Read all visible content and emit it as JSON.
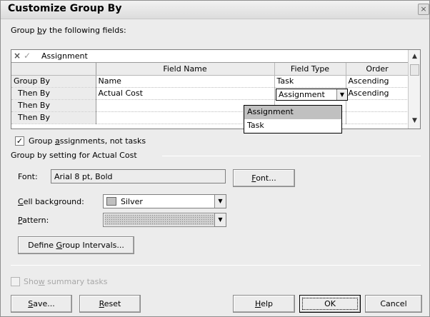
{
  "dialog": {
    "title": "Customize Group By",
    "close_glyph": "×",
    "group_fields_label_pre": "Group ",
    "group_fields_label_u": "b",
    "group_fields_label_post": "y the following fields:"
  },
  "edit_bar": {
    "cancel_glyph": "×",
    "accept_glyph": "✓",
    "value": "Assignment"
  },
  "table": {
    "headers": [
      "",
      "Field Name",
      "Field Type",
      "Order"
    ],
    "rows": [
      {
        "label": "Group By",
        "field_name": "Name",
        "field_type": "Task",
        "order": "Ascending"
      },
      {
        "label": "Then By",
        "field_name": "Actual Cost",
        "field_type": "Assignment",
        "order": "Ascending"
      },
      {
        "label": "Then By",
        "field_name": "",
        "field_type": "",
        "order": ""
      },
      {
        "label": "Then By",
        "field_name": "",
        "field_type": "",
        "order": ""
      }
    ]
  },
  "field_type_dropdown": {
    "options": [
      "Assignment",
      "Task"
    ],
    "selected": "Assignment"
  },
  "group_assignments": {
    "checked": true,
    "check_glyph": "✓",
    "label_pre": "Group ",
    "label_u": "a",
    "label_post": "ssignments, not tasks"
  },
  "settings": {
    "section_label": "Group by setting for Actual Cost",
    "font_label": "Font:",
    "font_value": "Arial 8 pt, Bold",
    "font_button_u": "F",
    "font_button_post": "ont...",
    "cell_bg_label_u": "C",
    "cell_bg_label_post": "ell background:",
    "cell_bg_value": "Silver",
    "cell_bg_color": "#c0c0c0",
    "pattern_label_u": "P",
    "pattern_label_post": "attern:",
    "define_intervals_pre": "Define ",
    "define_intervals_u": "G",
    "define_intervals_post": "roup Intervals..."
  },
  "summary": {
    "checked": false,
    "enabled": false,
    "label_pre": "Sho",
    "label_u": "w",
    "label_post": " summary tasks"
  },
  "buttons": {
    "save_u": "S",
    "save_post": "ave...",
    "reset_u": "R",
    "reset_post": "eset",
    "help_u": "H",
    "help_post": "elp",
    "ok": "OK",
    "cancel": "Cancel"
  },
  "scrollbar": {
    "up_glyph": "▲",
    "down_glyph": "▼"
  },
  "arrow_glyph": "▼"
}
